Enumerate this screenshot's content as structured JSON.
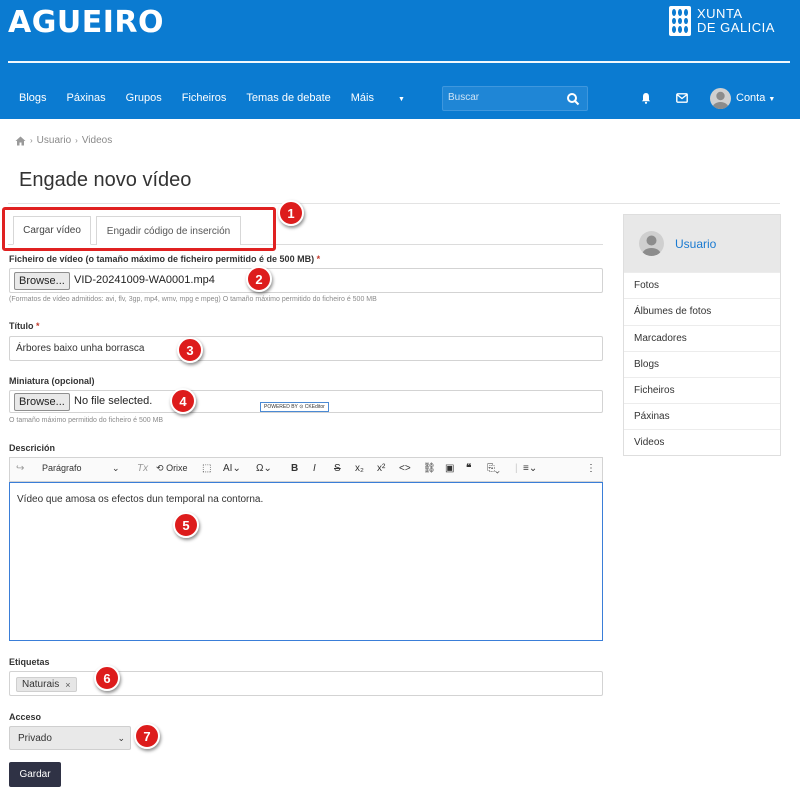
{
  "header": {
    "brand": "AGUEIRO",
    "org_line1": "XUNTA",
    "org_line2": "DE GALICIA",
    "nav": [
      {
        "label": "Blogs"
      },
      {
        "label": "Páxinas"
      },
      {
        "label": "Grupos"
      },
      {
        "label": "Ficheiros"
      },
      {
        "label": "Temas de debate"
      },
      {
        "label": "Máis"
      }
    ],
    "search_placeholder": "Buscar",
    "account_label": "Conta",
    "icons": [
      "search-icon",
      "bell-icon",
      "mail-icon",
      "user-avatar"
    ],
    "bg_color": "#0b7bd1"
  },
  "breadcrumb": {
    "items": [
      "Usuario",
      "Videos"
    ]
  },
  "page": {
    "title": "Engade novo vídeo"
  },
  "tabs": [
    {
      "label": "Cargar vídeo",
      "active": true
    },
    {
      "label": "Engadir código de inserción",
      "active": false
    }
  ],
  "form": {
    "video_file": {
      "label": "Ficheiro de vídeo (o tamaño máximo de ficheiro permitido é de 500 MB)",
      "required": "*",
      "button": "Browse...",
      "value": "VID-20241009-WA0001.mp4",
      "help": "(Formatos de vídeo admitidos: avi, flv, 3gp, mp4, wmv, mpg e mpeg) O tamaño máximo permitido do ficheiro é 500 MB"
    },
    "title": {
      "label": "Título",
      "required": "*",
      "value": "Árbores baixo unha borrasca"
    },
    "thumbnail": {
      "label": "Miniatura (opcional)",
      "button": "Browse...",
      "value": "No file selected.",
      "help": "O tamaño máximo permitido do ficheiro é 500 MB",
      "ck_badge": "POWERED BY ⊙ CKEditor"
    },
    "description": {
      "label": "Descrición",
      "toolbar": {
        "paragraph": "Parágrafo",
        "source": "Orixe"
      },
      "value": "Vídeo que amosa os efectos dun temporal na contorna."
    },
    "tags": {
      "label": "Etiquetas",
      "items": [
        "Naturais"
      ]
    },
    "access": {
      "label": "Acceso",
      "selected": "Privado"
    },
    "save_label": "Gardar"
  },
  "sidebar": {
    "user": "Usuario",
    "items": [
      {
        "label": "Fotos"
      },
      {
        "label": "Álbumes de fotos"
      },
      {
        "label": "Marcadores"
      },
      {
        "label": "Blogs"
      },
      {
        "label": "Ficheiros"
      },
      {
        "label": "Páxinas"
      },
      {
        "label": "Videos"
      }
    ]
  },
  "markers": [
    "1",
    "2",
    "3",
    "4",
    "5",
    "6",
    "7"
  ],
  "colors": {
    "accent": "#0b7bd1",
    "marker": "#dd1c1c",
    "save_button": "#2f3245"
  }
}
